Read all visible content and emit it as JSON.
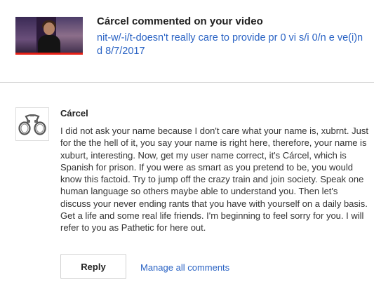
{
  "notification": {
    "title": "Cárcel commented on your video",
    "snippet": "nit-w/-i/t-doesn't really care to provide pr 0 vi s/i 0/n e ve(i)n d 8/7/2017",
    "thumbnail_icon": "video-thumbnail"
  },
  "comment": {
    "author": "Cárcel",
    "avatar_icon": "handcuffs-icon",
    "text": "I did not ask your name because I don't care what your name is, xubrnt. Just for the the hell of it, you say your name is right here, therefore, your name is xuburt, interesting. Now, get my user name correct, it's Cárcel, which is Spanish for prison. If you were as smart as you pretend to be, you would know this factoid. Try to jump off the crazy train and join society. Speak one human language so others maybe able to understand you. Then let's discuss your never ending rants that you have with yourself on a daily basis. Get a life and some real life friends. I'm beginning to feel sorry for you. I will refer to you as Pathetic for here out."
  },
  "actions": {
    "reply_label": "Reply",
    "manage_label": "Manage all comments"
  },
  "colors": {
    "link": "#2a63c4",
    "divider": "#d6d6d6",
    "progress": "#e62117"
  }
}
